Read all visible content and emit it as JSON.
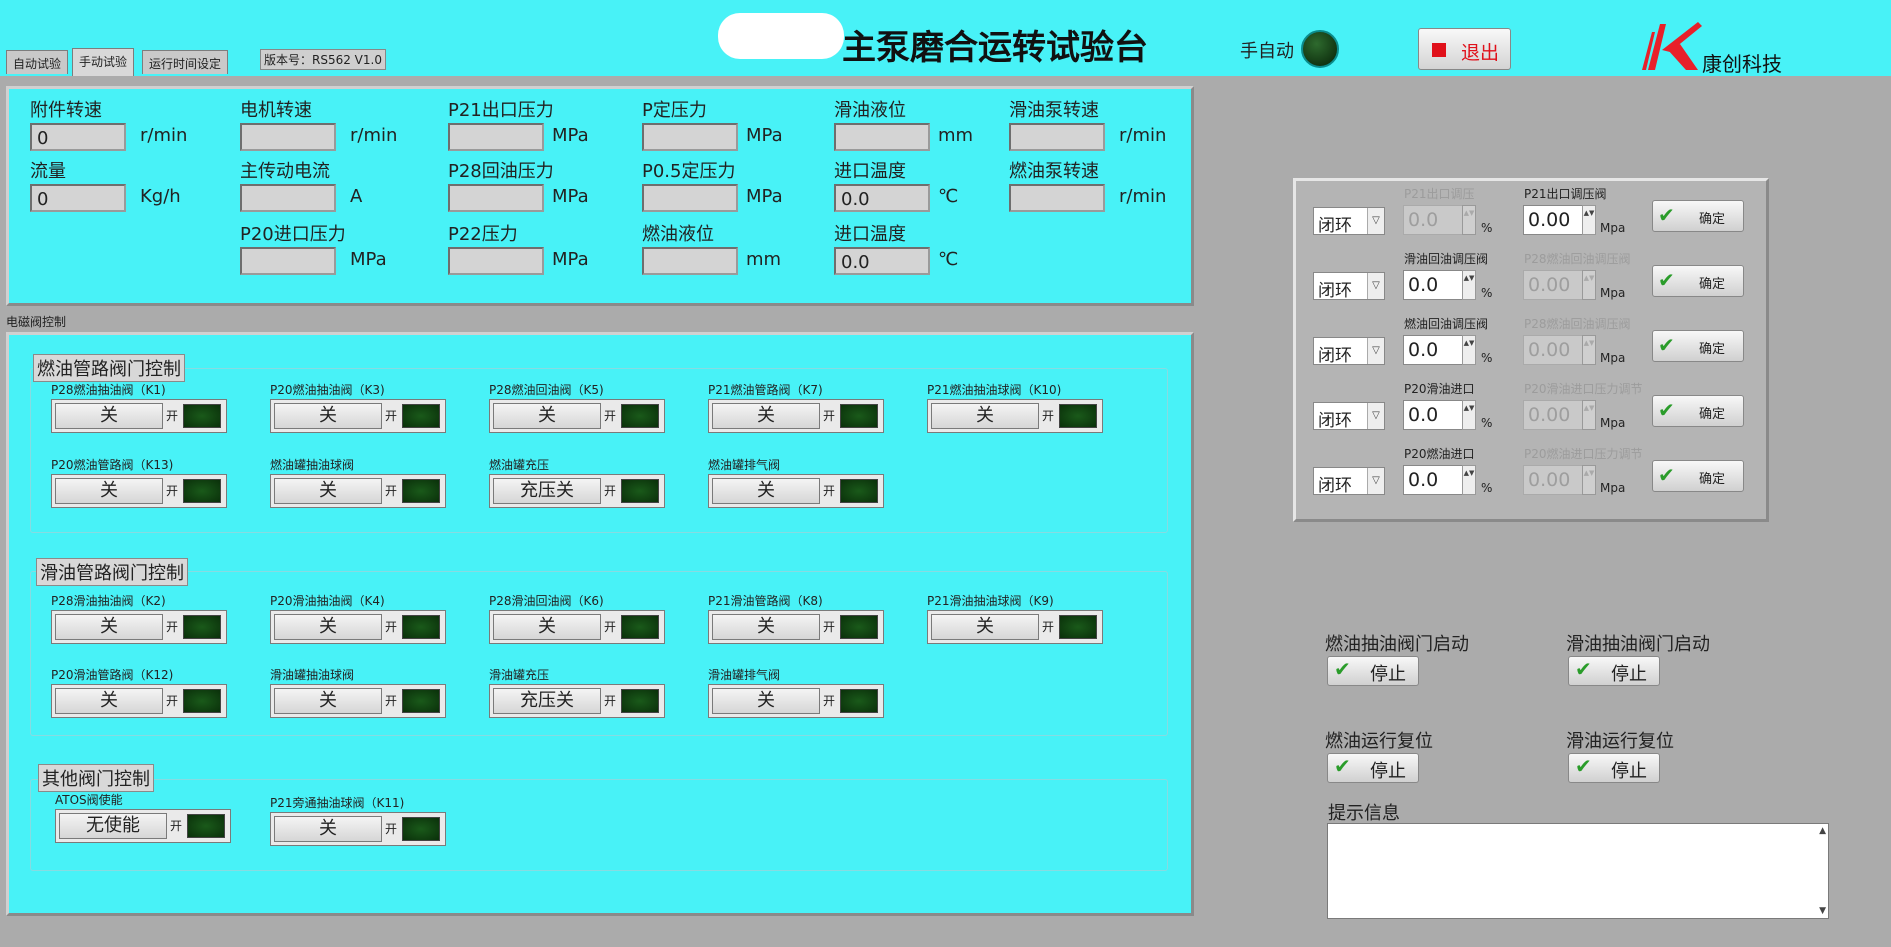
{
  "tabs": [
    "自动试验",
    "手动试验",
    "运行时间设定"
  ],
  "version": "版本号：RS562 V1.0",
  "title": "主泵磨合运转试验台",
  "auto_label": "手自动",
  "exit_label": "退出",
  "logo_text": "康创科技",
  "meas": [
    {
      "label": "附件转速",
      "value": "0",
      "unit": "r/min"
    },
    {
      "label": "电机转速",
      "value": "",
      "unit": "r/min"
    },
    {
      "label": "P21出口压力",
      "value": "",
      "unit": "MPa"
    },
    {
      "label": "P定压力",
      "value": "",
      "unit": "MPa"
    },
    {
      "label": "滑油液位",
      "value": "",
      "unit": "mm"
    },
    {
      "label": "滑油泵转速",
      "value": "",
      "unit": "r/min"
    },
    {
      "label": "流量",
      "value": "0",
      "unit": "Kg/h"
    },
    {
      "label": "主传动电流",
      "value": "",
      "unit": "A"
    },
    {
      "label": "P28回油压力",
      "value": "",
      "unit": "MPa"
    },
    {
      "label": "P0.5定压力",
      "value": "",
      "unit": "MPa"
    },
    {
      "label": "进口温度",
      "value": "0.0",
      "unit": "℃"
    },
    {
      "label": "燃油泵转速",
      "value": "",
      "unit": "r/min"
    },
    {
      "label": "P20进口压力",
      "value": "",
      "unit": "MPa"
    },
    {
      "label": "P22压力",
      "value": "",
      "unit": "MPa"
    },
    {
      "label": "燃油液位",
      "value": "",
      "unit": "mm"
    },
    {
      "label": "进口温度",
      "value": "0.0",
      "unit": "℃"
    }
  ],
  "valve_section_label": "电磁阀控制",
  "on_label": "开",
  "fuel": {
    "title": "燃油管路阀门控制",
    "valves": [
      {
        "label": "P28燃油抽油阀（K1)",
        "btn": "关"
      },
      {
        "label": "P20燃油抽油阀（K3)",
        "btn": "关"
      },
      {
        "label": "P28燃油回油阀（K5)",
        "btn": "关"
      },
      {
        "label": "P21燃油管路阀（K7)",
        "btn": "关"
      },
      {
        "label": "P21燃油抽油球阀（K10)",
        "btn": "关"
      },
      {
        "label": "P20燃油管路阀（K13)",
        "btn": "关"
      },
      {
        "label": "燃油罐抽油球阀",
        "btn": "关"
      },
      {
        "label": "燃油罐充压",
        "btn": "充压关"
      },
      {
        "label": "燃油罐排气阀",
        "btn": "关"
      }
    ]
  },
  "lube": {
    "title": "滑油管路阀门控制",
    "valves": [
      {
        "label": "P28滑油抽油阀（K2)",
        "btn": "关"
      },
      {
        "label": "P20滑油抽油阀（K4)",
        "btn": "关"
      },
      {
        "label": "P28滑油回油阀（K6)",
        "btn": "关"
      },
      {
        "label": "P21滑油管路阀（K8)",
        "btn": "关"
      },
      {
        "label": "P21滑油抽油球阀（K9)",
        "btn": "关"
      },
      {
        "label": "P20滑油管路阀（K12)",
        "btn": "关"
      },
      {
        "label": "滑油罐抽油球阀",
        "btn": "关"
      },
      {
        "label": "滑油罐充压",
        "btn": "充压关"
      },
      {
        "label": "滑油罐排气阀",
        "btn": "关"
      }
    ]
  },
  "other": {
    "title": "其他阀门控制",
    "valves": [
      {
        "label": "ATOS阀使能",
        "btn": "无使能"
      },
      {
        "label": "P21旁通抽油球阀（K11)",
        "btn": "关"
      }
    ]
  },
  "pressure_rows": [
    {
      "mode": "闭环",
      "l1": "P21出口调压",
      "v1": "0.0",
      "u1": "%",
      "l2": "P21出口调压阀",
      "v2": "0.00",
      "u2": "Mpa",
      "en1": false,
      "en2": true
    },
    {
      "mode": "闭环",
      "l1": "滑油回油调压阀",
      "v1": "0.0",
      "u1": "%",
      "l2": "P28燃油回油调压阀",
      "v2": "0.00",
      "u2": "Mpa",
      "en1": true,
      "en2": false
    },
    {
      "mode": "闭环",
      "l1": "燃油回油调压阀",
      "v1": "0.0",
      "u1": "%",
      "l2": "P28燃油回油调压阀",
      "v2": "0.00",
      "u2": "Mpa",
      "en1": true,
      "en2": false
    },
    {
      "mode": "闭环",
      "l1": "P20滑油进口",
      "v1": "0.0",
      "u1": "%",
      "l2": "P20滑油进口压力调节",
      "v2": "0.00",
      "u2": "Mpa",
      "en1": true,
      "en2": false
    },
    {
      "mode": "闭环",
      "l1": "P20燃油进口",
      "v1": "0.0",
      "u1": "%",
      "l2": "P20燃油进口压力调节",
      "v2": "0.00",
      "u2": "Mpa",
      "en1": true,
      "en2": false
    }
  ],
  "confirm_label": "确定",
  "actions": [
    {
      "label": "燃油抽油阀门启动",
      "btn": "停止"
    },
    {
      "label": "滑油抽油阀门启动",
      "btn": "停止"
    },
    {
      "label": "燃油运行复位",
      "btn": "停止"
    },
    {
      "label": "滑油运行复位",
      "btn": "停止"
    }
  ],
  "info_label": "提示信息",
  "colors": {
    "panel": "#48f2f7",
    "header": "#48f2f7",
    "led_off": "#0a300a",
    "exit_red": "#e0101a"
  }
}
